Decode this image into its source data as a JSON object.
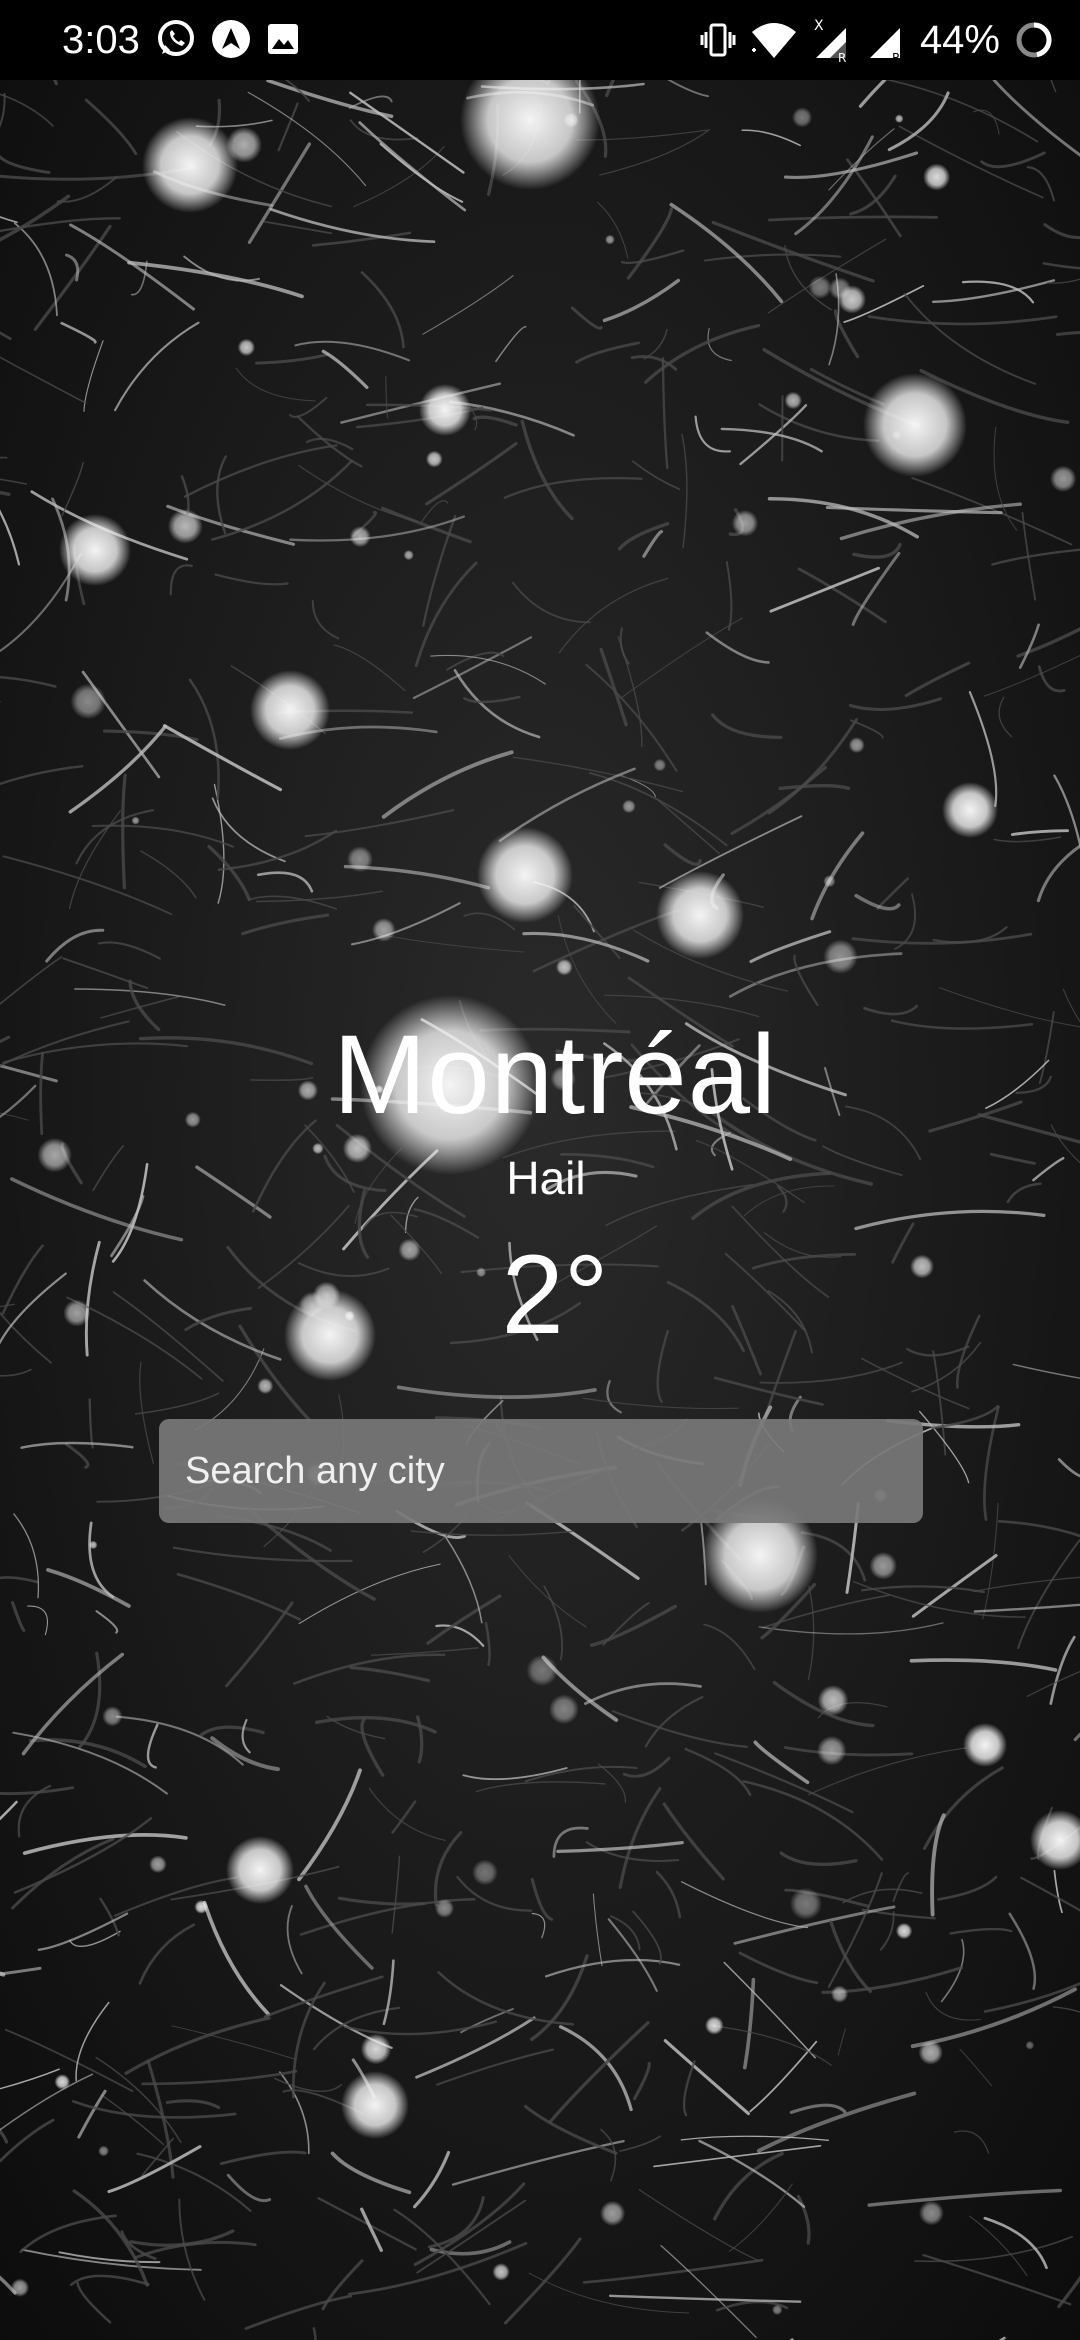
{
  "status_bar": {
    "time": "3:03",
    "battery_percent": "44%",
    "left_icons": [
      "whatsapp-icon",
      "nav-arrow-icon",
      "image-icon"
    ],
    "right_icons": [
      "vibrate-icon",
      "wifi-icon",
      "signal-x-icon",
      "signal-icon",
      "battery-ring-icon"
    ]
  },
  "weather": {
    "city": "Montréal",
    "condition": "Hail",
    "temperature": "2°"
  },
  "search": {
    "placeholder": "Search any city",
    "value": ""
  },
  "colors": {
    "status_bar_bg": "#000000",
    "search_bg": "#787878",
    "text": "#ffffff"
  }
}
